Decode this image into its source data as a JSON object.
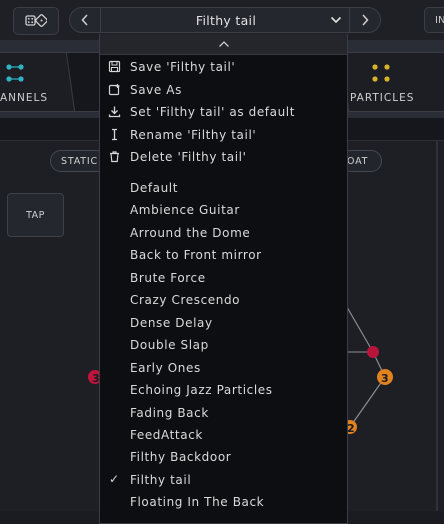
{
  "topbar": {
    "preset_name": "Filthy tail",
    "right_button_label": "IN"
  },
  "tabs": {
    "left_label": "ANNELS",
    "right_label": "PARTICLES"
  },
  "panel": {
    "static_chip": "STATIC",
    "right_chip": "OAT",
    "tap_button": "TAP",
    "node_labels": [
      "3",
      "3",
      "2"
    ]
  },
  "menu": {
    "actions": [
      {
        "label": "Save 'Filthy tail'",
        "icon": "save-icon"
      },
      {
        "label": "Save As",
        "icon": "save-as-icon"
      },
      {
        "label": "Set 'Filthy tail' as default",
        "icon": "download-icon"
      },
      {
        "label": "Rename 'Filthy tail'",
        "icon": "rename-cursor-icon"
      },
      {
        "label": "Delete 'Filthy tail'",
        "icon": "trash-icon"
      }
    ],
    "presets": [
      "Default",
      "Ambience Guitar",
      "Arround the Dome",
      "Back to Front mirror",
      "Brute Force",
      "Crazy Crescendo",
      "Dense Delay",
      "Double Slap",
      "Early Ones",
      "Echoing Jazz Particles",
      "Fading Back",
      "FeedAttack",
      "Filthy Backdoor",
      "Filthy tail",
      "Floating In The Back"
    ],
    "selected_preset": "Filthy tail",
    "check_glyph": "✓"
  },
  "colors": {
    "accent_cyan": "#2fb4c4",
    "accent_yellow": "#d8b32a",
    "node_red": "#c0143c",
    "node_orange": "#e0831f"
  }
}
